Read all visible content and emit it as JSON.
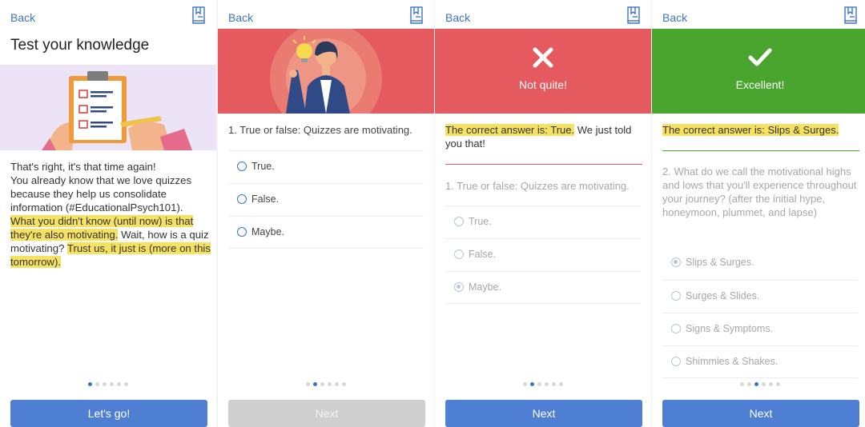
{
  "colors": {
    "accent": "#3d72c7",
    "button_blue": "#4f7fd3",
    "wrong_red": "#e55a5f",
    "correct_green": "#4aa52e",
    "highlight": "#f6e262"
  },
  "screen1": {
    "back": "Back",
    "title": "Test your knowledge",
    "intro_lines": [
      "That's right, it's that time again!",
      "You already know that we love quizzes because they help us consolidate information (#EducationalPsych101)."
    ],
    "hl1": "What you didn't know (until now) is that they're also motivating.",
    "mid": " Wait, how is a quiz motivating? ",
    "hl2": "Trust us, it just is (more on this tomorrow).",
    "button": "Let's go!"
  },
  "screen2": {
    "back": "Back",
    "question": "1. True or false: Quizzes are motivating.",
    "options": [
      "True.",
      "False.",
      "Maybe."
    ],
    "button": "Next"
  },
  "screen3": {
    "back": "Back",
    "banner_text": "Not quite!",
    "answer_hl": "The correct answer is: True.",
    "answer_rest": " We just told you that!",
    "question": "1. True or false: Quizzes are motivating.",
    "options": [
      "True.",
      "False.",
      "Maybe."
    ],
    "button": "Next"
  },
  "screen4": {
    "back": "Back",
    "banner_text": "Excellent!",
    "answer_hl": "The correct answer is: Slips & Surges.",
    "question": "2. What do we call the motivational highs and lows that you'll experience throughout your journey? (after the initial hype, honeymoon, plummet, and lapse)",
    "options": [
      "Slips & Surges.",
      "Surges & Slides.",
      "Signs & Symptoms.",
      "Shimmies & Shakes."
    ],
    "button": "Next"
  },
  "pagination": {
    "total": 6,
    "active": [
      0,
      1,
      1,
      2
    ]
  },
  "icons": [
    "bookmark-icon",
    "clipboard-illustration",
    "businesswoman-idea-illustration",
    "x-mark-icon",
    "checkmark-icon",
    "radio-icon"
  ]
}
